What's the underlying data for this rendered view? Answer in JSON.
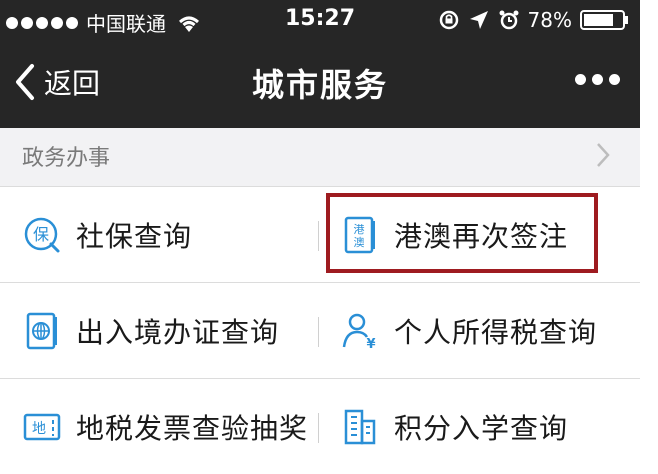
{
  "status_bar": {
    "carrier": "中国联通",
    "time": "15:27",
    "battery": "78%"
  },
  "nav": {
    "back_label": "返回",
    "title": "城市服务"
  },
  "section": {
    "title": "政务办事"
  },
  "services": [
    {
      "left": "社保查询",
      "right": "港澳再次签注"
    },
    {
      "left": "出入境办证查询",
      "right": "个人所得税查询"
    },
    {
      "left": "地税发票查验抽奖",
      "right": "积分入学查询"
    }
  ],
  "icon_labels": {
    "bao": "保",
    "gang": "港",
    "ao": "澳",
    "di": "地",
    "yen": "¥"
  },
  "colors": {
    "accent_blue": "#2a8fd6",
    "highlight_red": "#9e1b20",
    "topbar_bg": "#262626"
  }
}
